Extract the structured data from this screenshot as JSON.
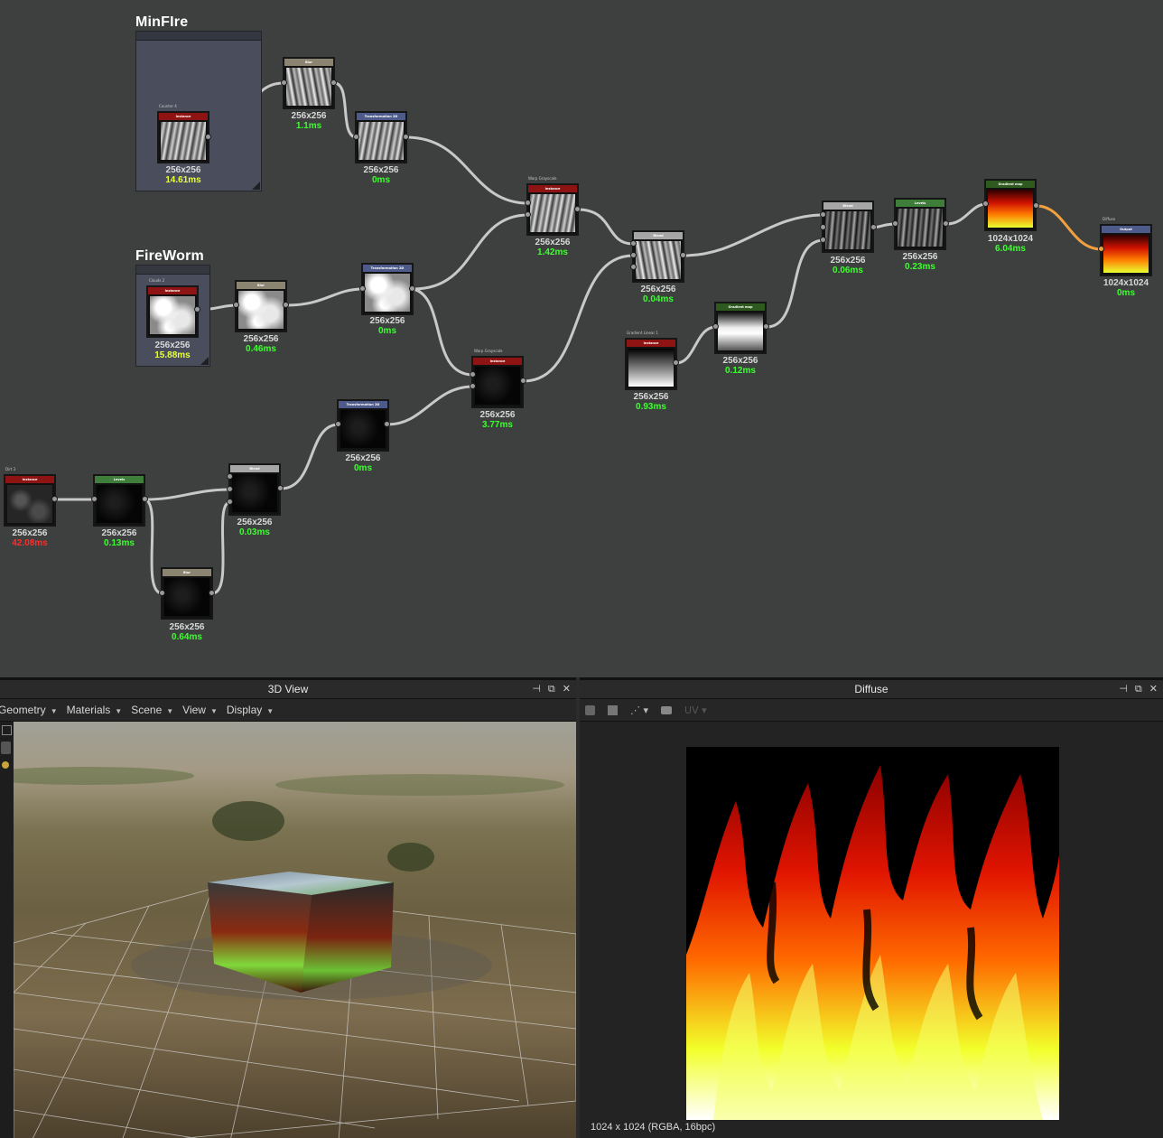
{
  "graph": {
    "frames": {
      "minfire": {
        "title": "MinFIre"
      },
      "fireworm": {
        "title": "FireWorm"
      }
    },
    "nodes": {
      "n_instance_a": {
        "label": "Instance",
        "caption_name": "Counter 4",
        "res": "256x256",
        "time": "14.61ms"
      },
      "n_blur_a": {
        "label": "Blur",
        "res": "256x256",
        "time": "1.1ms"
      },
      "n_transform_a": {
        "label": "Transformation 2D",
        "res": "256x256",
        "time": "0ms"
      },
      "n_instance_b": {
        "label": "Instance",
        "caption_name": "Clouds 2",
        "res": "256x256",
        "time": "15.88ms"
      },
      "n_blur_b": {
        "label": "Blur",
        "res": "256x256",
        "time": "0.46ms"
      },
      "n_transform_b": {
        "label": "Transformation 2D",
        "res": "256x256",
        "time": "0ms"
      },
      "n_instance_c": {
        "label": "Instance",
        "caption_name": "Warp Grayscale",
        "res": "256x256",
        "time": "1.42ms"
      },
      "n_blend_a": {
        "label": "Blend",
        "res": "256x256",
        "time": "0.04ms"
      },
      "n_instance_d": {
        "label": "Instance",
        "caption_name": "Warp Grayscale",
        "res": "256x256",
        "time": "3.77ms"
      },
      "n_instance_e": {
        "label": "Instance",
        "caption_name": "Dirt 3",
        "res": "256x256",
        "time": "42.08ms"
      },
      "n_levels_a": {
        "label": "Levels",
        "res": "256x256",
        "time": "0.13ms"
      },
      "n_blend_b": {
        "label": "Blend",
        "res": "256x256",
        "time": "0.03ms"
      },
      "n_blur_c": {
        "label": "Blur",
        "res": "256x256",
        "time": "0.64ms"
      },
      "n_transform_c": {
        "label": "Transformation 2D",
        "res": "256x256",
        "time": "0ms"
      },
      "n_instance_f": {
        "label": "Instance",
        "caption_name": "Gradient Linear 1",
        "res": "256x256",
        "time": "0.93ms"
      },
      "n_gradmap_a": {
        "label": "Gradient map",
        "res": "256x256",
        "time": "0.12ms"
      },
      "n_blend_c": {
        "label": "Blend",
        "res": "256x256",
        "time": "0.06ms"
      },
      "n_levels_b": {
        "label": "Levels",
        "res": "256x256",
        "time": "0.23ms"
      },
      "n_gradmap_b": {
        "label": "Gradient map",
        "res": "1024x1024",
        "time": "6.04ms"
      },
      "n_output": {
        "label": "Output",
        "caption_name": "Diffuse",
        "res": "1024x1024",
        "time": "0ms"
      }
    }
  },
  "panel3d": {
    "title": "3D View",
    "menus": [
      "Geometry",
      "Materials",
      "Scene",
      "View",
      "Display"
    ],
    "buttons": {
      "pin": "⊣",
      "float": "⧉",
      "close": "✕"
    }
  },
  "panelDiffuse": {
    "title": "Diffuse",
    "toolbar": {
      "uv_label": "UV"
    },
    "status": "1024 x 1024 (RGBA, 16bpc)",
    "buttons": {
      "pin": "⊣",
      "float": "⧉",
      "close": "✕"
    }
  },
  "colors": {
    "graph_bg": "#3d403e",
    "wire": "#c8c8c8",
    "wire_active": "#f0a040",
    "time_green": "#3cff2e",
    "time_yellow": "#e9ff3a",
    "time_red": "#ff2c2c"
  }
}
